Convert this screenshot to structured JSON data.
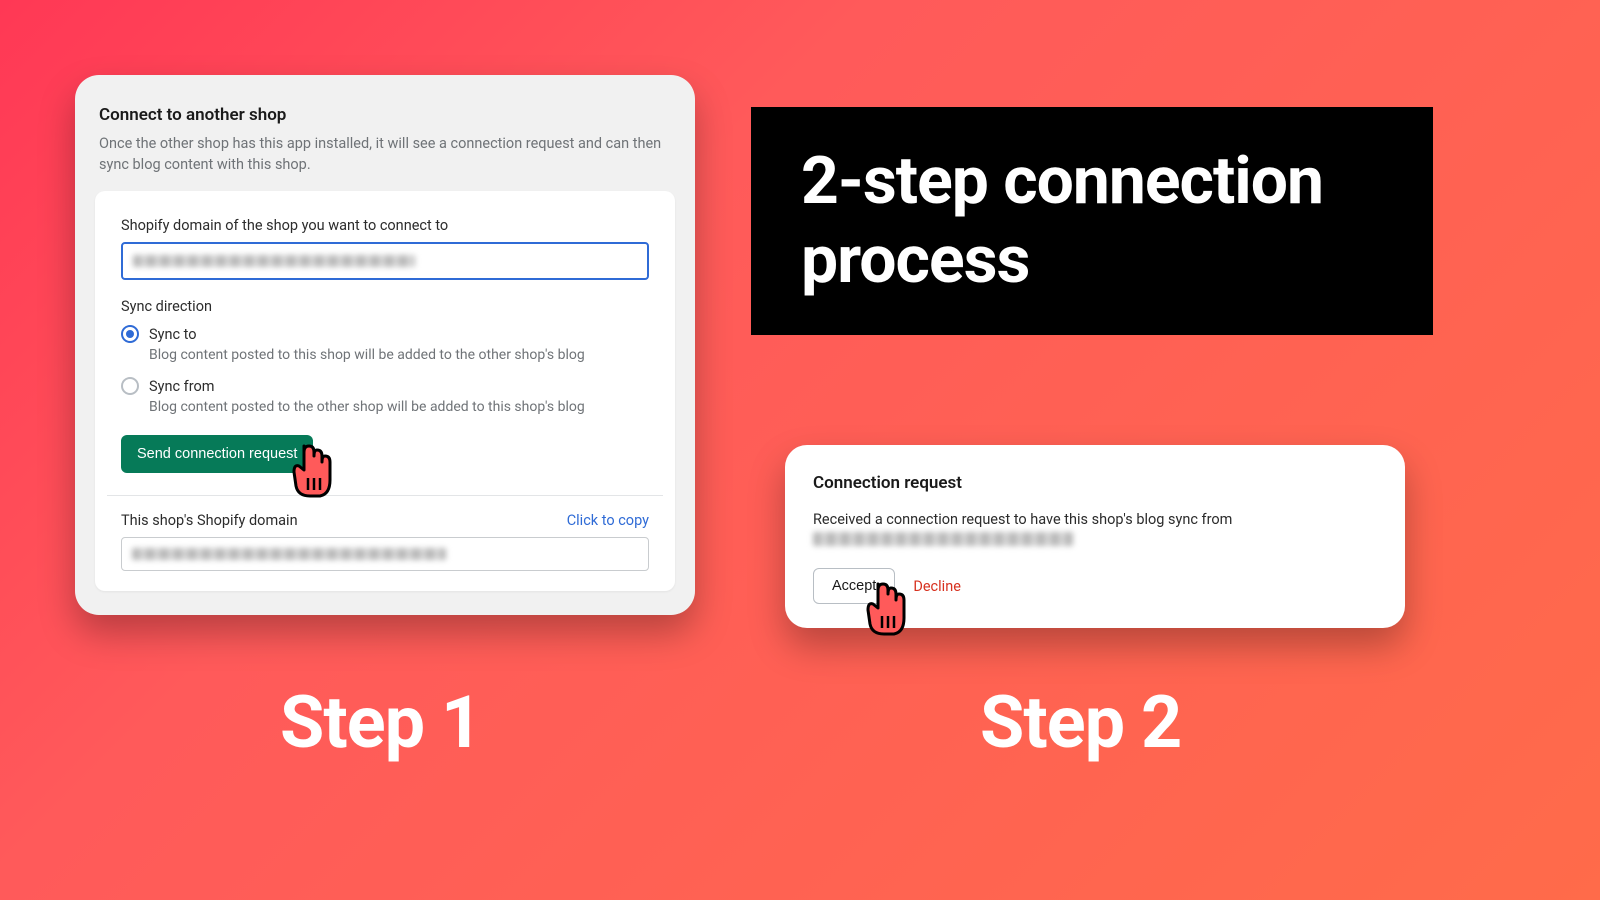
{
  "banner": {
    "title": "2-step connection process"
  },
  "card1": {
    "title": "Connect to another shop",
    "desc": "Once the other shop has this app installed, it will see a connection request and can then sync blog content with this shop.",
    "domain_label": "Shopify domain of the shop you want to connect to",
    "sync_direction_label": "Sync direction",
    "sync_to": {
      "label": "Sync to",
      "help": "Blog content posted to this shop will be added to the other shop's blog"
    },
    "sync_from": {
      "label": "Sync from",
      "help": "Blog content posted to the other shop will be added to this shop's blog"
    },
    "send_button": "Send connection request",
    "this_domain_label": "This shop's Shopify domain",
    "copy_label": "Click to copy"
  },
  "card2": {
    "title": "Connection request",
    "msg": "Received a connection request to have this shop's blog sync from",
    "accept": "Accept",
    "decline": "Decline"
  },
  "steps": {
    "one": "Step 1",
    "two": "Step 2"
  }
}
